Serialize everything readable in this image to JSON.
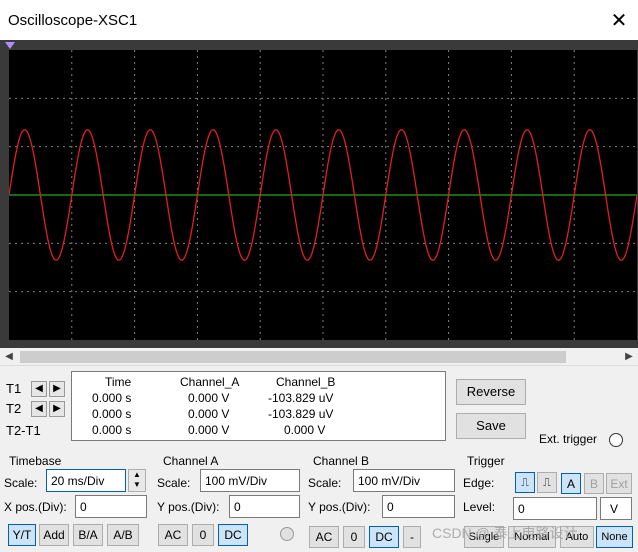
{
  "window": {
    "title": "Oscilloscope-XSC1",
    "close_icon": "close-icon"
  },
  "readout": {
    "headers": [
      "Time",
      "Channel_A",
      "Channel_B"
    ],
    "rows": [
      {
        "label": "T1",
        "time": "0.000 s",
        "a": "0.000 V",
        "b": "-103.829 uV"
      },
      {
        "label": "T2",
        "time": "0.000 s",
        "a": "0.000 V",
        "b": "-103.829 uV"
      },
      {
        "label": "T2-T1",
        "time": "0.000 s",
        "a": "0.000 V",
        "b": "0.000 V"
      }
    ]
  },
  "buttons": {
    "reverse": "Reverse",
    "save": "Save",
    "ext_trigger": "Ext. trigger"
  },
  "timebase": {
    "title": "Timebase",
    "scale_label": "Scale:",
    "scale": "20 ms/Div",
    "xpos_label": "X pos.(Div):",
    "xpos": "0",
    "modes": [
      "Y/T",
      "Add",
      "B/A",
      "A/B"
    ]
  },
  "channel_a": {
    "title": "Channel A",
    "scale_label": "Scale:",
    "scale": "100 mV/Div",
    "ypos_label": "Y pos.(Div):",
    "ypos": "0",
    "coupling": [
      "AC",
      "0",
      "DC"
    ]
  },
  "channel_b": {
    "title": "Channel B",
    "scale_label": "Scale:",
    "scale": "100 mV/Div",
    "ypos_label": "Y pos.(Div):",
    "ypos": "0",
    "coupling": [
      "AC",
      "0",
      "DC",
      "-"
    ]
  },
  "trigger": {
    "title": "Trigger",
    "edge_label": "Edge:",
    "sources": [
      "A",
      "B",
      "Ext"
    ],
    "level_label": "Level:",
    "level": "0",
    "unit": "V",
    "modes": [
      "Single",
      "Normal",
      "Auto",
      "None"
    ]
  },
  "watermark": "CSDN @ 泰上电路设计",
  "waveform": {
    "color": "#e02020",
    "cycles": 10,
    "amplitude_div": 1.35,
    "grid_color": "#808080",
    "axis_color": "#2fd02f"
  }
}
